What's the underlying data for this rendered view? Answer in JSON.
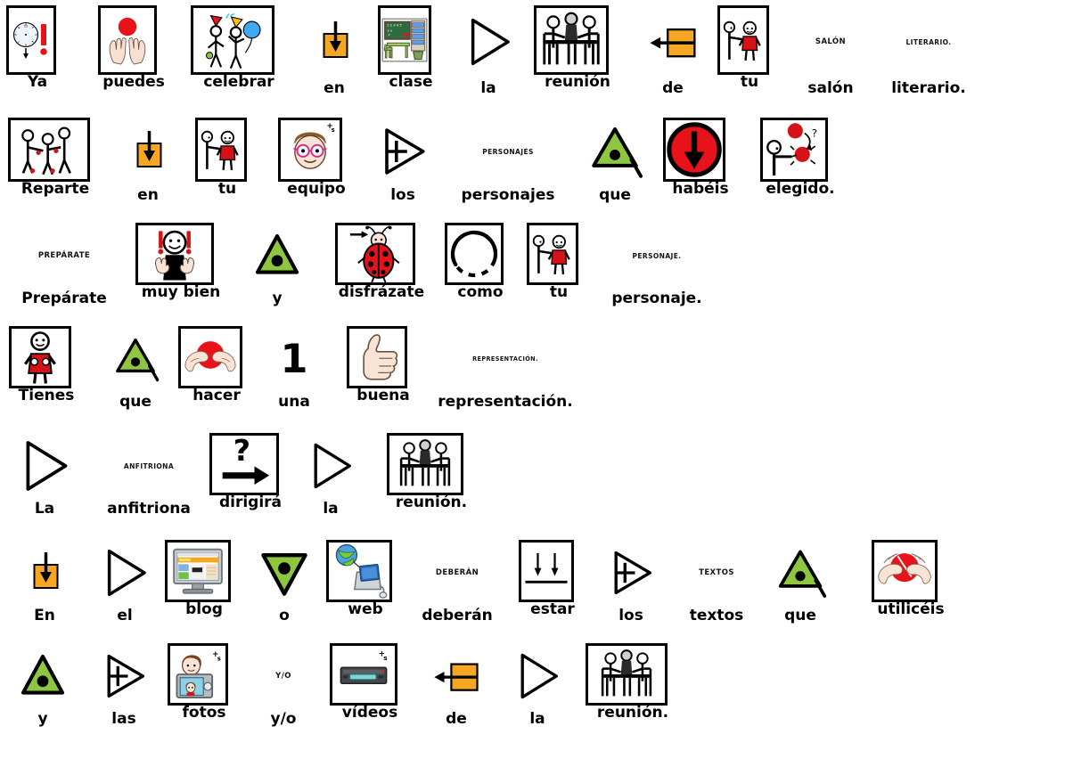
{
  "document": {
    "title": "Ya puedes celebrar en clase la reunión de tu salón literario.",
    "language": "es",
    "pictogram_style": "ARASAAC",
    "frame_colors": {
      "blue": "#0000ee",
      "green": "#00e000",
      "orange": "#ffc107",
      "none": "transparent"
    },
    "sentences": [
      "Ya puedes celebrar en clase la reunión de tu salón literario.",
      "Reparte en tu equipo los personajes que habéis elegido.",
      "Prepárate muy bien y disfrázate como tu personaje.",
      "Tienes que hacer una buena representación.",
      "La anfitriona dirigirá la reunión.",
      "En el blog o web deberán estar los textos que utilicéis",
      "y las fotos y/o vídeos de la reunión."
    ]
  },
  "rows": [
    {
      "index": 1,
      "items": [
        {
          "word": "Ya",
          "frame": "blue",
          "icon": "clock-arrow-down-exclamation-icon",
          "micro": null
        },
        {
          "word": "puedes",
          "frame": "green",
          "icon": "hands-catching-red-ball-icon",
          "micro": null
        },
        {
          "word": "celebrar",
          "frame": "green",
          "icon": "party-people-balloons-icon",
          "micro": null
        },
        {
          "word": "en",
          "frame": "none",
          "icon": "orange-square-arrow-down-icon",
          "micro": null
        },
        {
          "word": "clase",
          "frame": "orange",
          "icon": "classroom-desk-blackboard-icon",
          "micro": null
        },
        {
          "word": "la",
          "frame": "none",
          "icon": "triangle-outline-right-icon",
          "micro": null
        },
        {
          "word": "reunión",
          "frame": "orange",
          "icon": "meeting-table-three-people-icon",
          "micro": null
        },
        {
          "word": "de",
          "frame": "none",
          "icon": "orange-square-arrow-left-icon",
          "micro": null
        },
        {
          "word": "tu",
          "frame": "blue",
          "icon": "person-pointing-to-person-icon",
          "micro": null
        },
        {
          "word": "salón",
          "frame": "none",
          "icon": null,
          "micro": "SALÓN"
        },
        {
          "word": "literario.",
          "frame": "none",
          "icon": null,
          "micro": "LITERARIO."
        }
      ]
    },
    {
      "index": 2,
      "items": [
        {
          "word": "Reparte",
          "frame": "green",
          "icon": "three-people-sharing-icon",
          "micro": null
        },
        {
          "word": "en",
          "frame": "none",
          "icon": "orange-square-arrow-down-icon",
          "micro": null
        },
        {
          "word": "tu",
          "frame": "blue",
          "icon": "person-pointing-to-person-icon",
          "micro": null
        },
        {
          "word": "equipo",
          "frame": "orange",
          "icon": "child-face-glasses-plural-icon",
          "micro": null
        },
        {
          "word": "los",
          "frame": "none",
          "icon": "triangle-plus-right-icon",
          "micro": null
        },
        {
          "word": "personajes",
          "frame": "none",
          "icon": null,
          "micro": "PERSONAJES"
        },
        {
          "word": "que",
          "frame": "none",
          "icon": "green-triangle-dot-tail-icon",
          "micro": null
        },
        {
          "word": "habéis",
          "frame": "green",
          "icon": "red-circle-arrow-down-icon",
          "micro": null
        },
        {
          "word": "elegido.",
          "frame": "green",
          "icon": "person-choosing-red-balls-icon",
          "micro": null
        }
      ]
    },
    {
      "index": 3,
      "items": [
        {
          "word": "Prepárate",
          "frame": "none",
          "icon": null,
          "micro": "PREPÁRATE"
        },
        {
          "word": "muy bien",
          "frame": "blue",
          "icon": "person-thumbs-up-exclamations-icon",
          "micro": null
        },
        {
          "word": "y",
          "frame": "none",
          "icon": "green-triangle-dot-icon",
          "micro": null
        },
        {
          "word": "disfrázate",
          "frame": "orange",
          "icon": "ladybug-costume-arrow-icon",
          "micro": null
        },
        {
          "word": "como",
          "frame": "blue",
          "icon": "dashed-circle-icon",
          "micro": null
        },
        {
          "word": "tu",
          "frame": "blue",
          "icon": "person-pointing-to-person-icon",
          "micro": null
        },
        {
          "word": "personaje.",
          "frame": "none",
          "icon": null,
          "micro": "PERSONAJE."
        }
      ]
    },
    {
      "index": 4,
      "items": [
        {
          "word": "Tienes",
          "frame": "green",
          "icon": "person-holding-red-object-icon",
          "micro": null
        },
        {
          "word": "que",
          "frame": "none",
          "icon": "green-triangle-dot-tail-icon",
          "micro": null
        },
        {
          "word": "hacer",
          "frame": "green",
          "icon": "hands-shaping-red-ball-icon",
          "micro": null
        },
        {
          "word": "una",
          "frame": "none",
          "icon": "number-one-icon",
          "micro": null
        },
        {
          "word": "buena",
          "frame": "blue",
          "icon": "thumbs-up-icon",
          "micro": null
        },
        {
          "word": "representación.",
          "frame": "none",
          "icon": null,
          "micro": "REPRESENTACIÓN."
        }
      ]
    },
    {
      "index": 5,
      "items": [
        {
          "word": "La",
          "frame": "none",
          "icon": "triangle-outline-right-icon",
          "micro": null
        },
        {
          "word": "anfitriona",
          "frame": "none",
          "icon": null,
          "micro": "ANFITRIONA"
        },
        {
          "word": "dirigirá",
          "frame": "green",
          "icon": "question-mark-arrow-right-icon",
          "micro": null
        },
        {
          "word": "la",
          "frame": "none",
          "icon": "triangle-outline-right-icon",
          "micro": null
        },
        {
          "word": "reunión.",
          "frame": "orange",
          "icon": "meeting-table-three-people-icon",
          "micro": null
        }
      ]
    },
    {
      "index": 6,
      "items": [
        {
          "word": "En",
          "frame": "none",
          "icon": "orange-square-arrow-down-icon",
          "micro": null
        },
        {
          "word": "el",
          "frame": "none",
          "icon": "triangle-outline-right-icon",
          "micro": null
        },
        {
          "word": "blog",
          "frame": "orange",
          "icon": "computer-monitor-webpage-icon",
          "micro": null
        },
        {
          "word": "o",
          "frame": "none",
          "icon": "green-triangle-down-dot-icon",
          "micro": null
        },
        {
          "word": "web",
          "frame": "orange",
          "icon": "globe-laptop-icon",
          "micro": null
        },
        {
          "word": "deberán",
          "frame": "none",
          "icon": null,
          "micro": "DEBERÁN"
        },
        {
          "word": "estar",
          "frame": "green",
          "icon": "two-arrows-down-line-icon",
          "micro": null
        },
        {
          "word": "los",
          "frame": "none",
          "icon": "triangle-plus-right-icon",
          "micro": null
        },
        {
          "word": "textos",
          "frame": "none",
          "icon": null,
          "micro": "TEXTOS"
        },
        {
          "word": "que",
          "frame": "none",
          "icon": "green-triangle-dot-tail-icon",
          "micro": null
        },
        {
          "word": "utilicéis",
          "frame": "green",
          "icon": "hands-using-red-ball-icon",
          "micro": null
        }
      ]
    },
    {
      "index": 7,
      "items": [
        {
          "word": "y",
          "frame": "none",
          "icon": "green-triangle-dot-icon",
          "micro": null
        },
        {
          "word": "las",
          "frame": "none",
          "icon": "triangle-plus-right-icon",
          "micro": null
        },
        {
          "word": "fotos",
          "frame": "orange",
          "icon": "camera-photo-person-plural-icon",
          "micro": null
        },
        {
          "word": "y/o",
          "frame": "none",
          "icon": null,
          "micro": "Y/O"
        },
        {
          "word": "vídeos",
          "frame": "orange",
          "icon": "video-player-device-plural-icon",
          "micro": null
        },
        {
          "word": "de",
          "frame": "none",
          "icon": "orange-square-arrow-left-icon",
          "micro": null
        },
        {
          "word": "la",
          "frame": "none",
          "icon": "triangle-outline-right-icon",
          "micro": null
        },
        {
          "word": "reunión.",
          "frame": "orange",
          "icon": "meeting-table-three-people-icon",
          "micro": null
        }
      ]
    }
  ]
}
